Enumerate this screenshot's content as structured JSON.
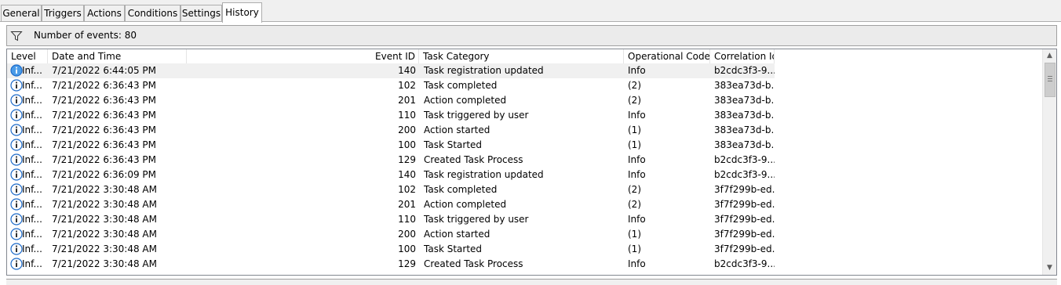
{
  "tabs": [
    {
      "label": "General"
    },
    {
      "label": "Triggers"
    },
    {
      "label": "Actions"
    },
    {
      "label": "Conditions"
    },
    {
      "label": "Settings"
    },
    {
      "label": "History"
    }
  ],
  "active_tab": "History",
  "toolbar": {
    "event_count_text": "Number of events: 80",
    "filter_icon": "filter-icon"
  },
  "columns": {
    "level": "Level",
    "date_time": "Date and Time",
    "event_id": "Event ID",
    "task_category": "Task Category",
    "operational_code": "Operational Code",
    "correlation_id": "Correlation Id"
  },
  "rows": [
    {
      "level": "Inf...",
      "date": "7/21/2022 6:44:05 PM",
      "event_id": "140",
      "category": "Task registration updated",
      "opcode": "Info",
      "correlation": "b2cdc3f3-9..."
    },
    {
      "level": "Inf...",
      "date": "7/21/2022 6:36:43 PM",
      "event_id": "102",
      "category": "Task completed",
      "opcode": "(2)",
      "correlation": "383ea73d-b..."
    },
    {
      "level": "Inf...",
      "date": "7/21/2022 6:36:43 PM",
      "event_id": "201",
      "category": "Action completed",
      "opcode": "(2)",
      "correlation": "383ea73d-b..."
    },
    {
      "level": "Inf...",
      "date": "7/21/2022 6:36:43 PM",
      "event_id": "110",
      "category": "Task triggered by user",
      "opcode": "Info",
      "correlation": "383ea73d-b..."
    },
    {
      "level": "Inf...",
      "date": "7/21/2022 6:36:43 PM",
      "event_id": "200",
      "category": "Action started",
      "opcode": "(1)",
      "correlation": "383ea73d-b..."
    },
    {
      "level": "Inf...",
      "date": "7/21/2022 6:36:43 PM",
      "event_id": "100",
      "category": "Task Started",
      "opcode": "(1)",
      "correlation": "383ea73d-b..."
    },
    {
      "level": "Inf...",
      "date": "7/21/2022 6:36:43 PM",
      "event_id": "129",
      "category": "Created Task Process",
      "opcode": "Info",
      "correlation": "b2cdc3f3-9..."
    },
    {
      "level": "Inf...",
      "date": "7/21/2022 6:36:09 PM",
      "event_id": "140",
      "category": "Task registration updated",
      "opcode": "Info",
      "correlation": "b2cdc3f3-9..."
    },
    {
      "level": "Inf...",
      "date": "7/21/2022 3:30:48 AM",
      "event_id": "102",
      "category": "Task completed",
      "opcode": "(2)",
      "correlation": "3f7f299b-ed..."
    },
    {
      "level": "Inf...",
      "date": "7/21/2022 3:30:48 AM",
      "event_id": "201",
      "category": "Action completed",
      "opcode": "(2)",
      "correlation": "3f7f299b-ed..."
    },
    {
      "level": "Inf...",
      "date": "7/21/2022 3:30:48 AM",
      "event_id": "110",
      "category": "Task triggered by user",
      "opcode": "Info",
      "correlation": "3f7f299b-ed..."
    },
    {
      "level": "Inf...",
      "date": "7/21/2022 3:30:48 AM",
      "event_id": "200",
      "category": "Action started",
      "opcode": "(1)",
      "correlation": "3f7f299b-ed..."
    },
    {
      "level": "Inf...",
      "date": "7/21/2022 3:30:48 AM",
      "event_id": "100",
      "category": "Task Started",
      "opcode": "(1)",
      "correlation": "3f7f299b-ed..."
    },
    {
      "level": "Inf...",
      "date": "7/21/2022 3:30:48 AM",
      "event_id": "129",
      "category": "Created Task Process",
      "opcode": "Info",
      "correlation": "b2cdc3f3-9..."
    }
  ],
  "selected_row": 0,
  "colors": {
    "selected_row_bg": "#f0f0f0",
    "info_icon_blue": "#1c6ac9",
    "selected_info_icon_fill": "#4a9be8"
  },
  "icons": {
    "row_level_icon": "info-icon",
    "scroll_up": "scroll-up-arrow-icon",
    "scroll_down": "scroll-down-arrow-icon"
  }
}
